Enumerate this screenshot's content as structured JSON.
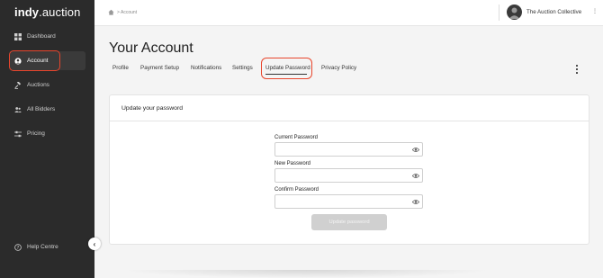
{
  "app": {
    "logo_brand": "indy",
    "logo_rest": ".auction"
  },
  "sidebar": {
    "items": [
      {
        "label": "Dashboard",
        "icon": "grid-icon",
        "active": false
      },
      {
        "label": "Account",
        "icon": "user-circle-icon",
        "active": true
      },
      {
        "label": "Auctions",
        "icon": "gavel-icon",
        "active": false
      },
      {
        "label": "All Bidders",
        "icon": "users-icon",
        "active": false
      },
      {
        "label": "Pricing",
        "icon": "sliders-icon",
        "active": false
      }
    ],
    "help_label": "Help Centre",
    "collapse_glyph": "‹"
  },
  "header": {
    "breadcrumb": "> Account",
    "org_name": "The Auction Collective",
    "org_caret": "⋮"
  },
  "main": {
    "title": "Your Account",
    "tabs": [
      {
        "label": "Profile"
      },
      {
        "label": "Payment Setup"
      },
      {
        "label": "Notifications"
      },
      {
        "label": "Settings"
      },
      {
        "label": "Update Password",
        "active": true
      },
      {
        "label": "Privacy Policy"
      }
    ]
  },
  "form": {
    "card_title": "Update your password",
    "fields": [
      {
        "label": "Current Password",
        "value": ""
      },
      {
        "label": "New Password",
        "value": ""
      },
      {
        "label": "Confirm Password",
        "value": ""
      }
    ],
    "submit_label": "Update password"
  },
  "colors": {
    "sidebar_bg": "#2b2b2b",
    "highlight_ring": "#e8452c",
    "disabled_button": "#d0d0d0"
  }
}
